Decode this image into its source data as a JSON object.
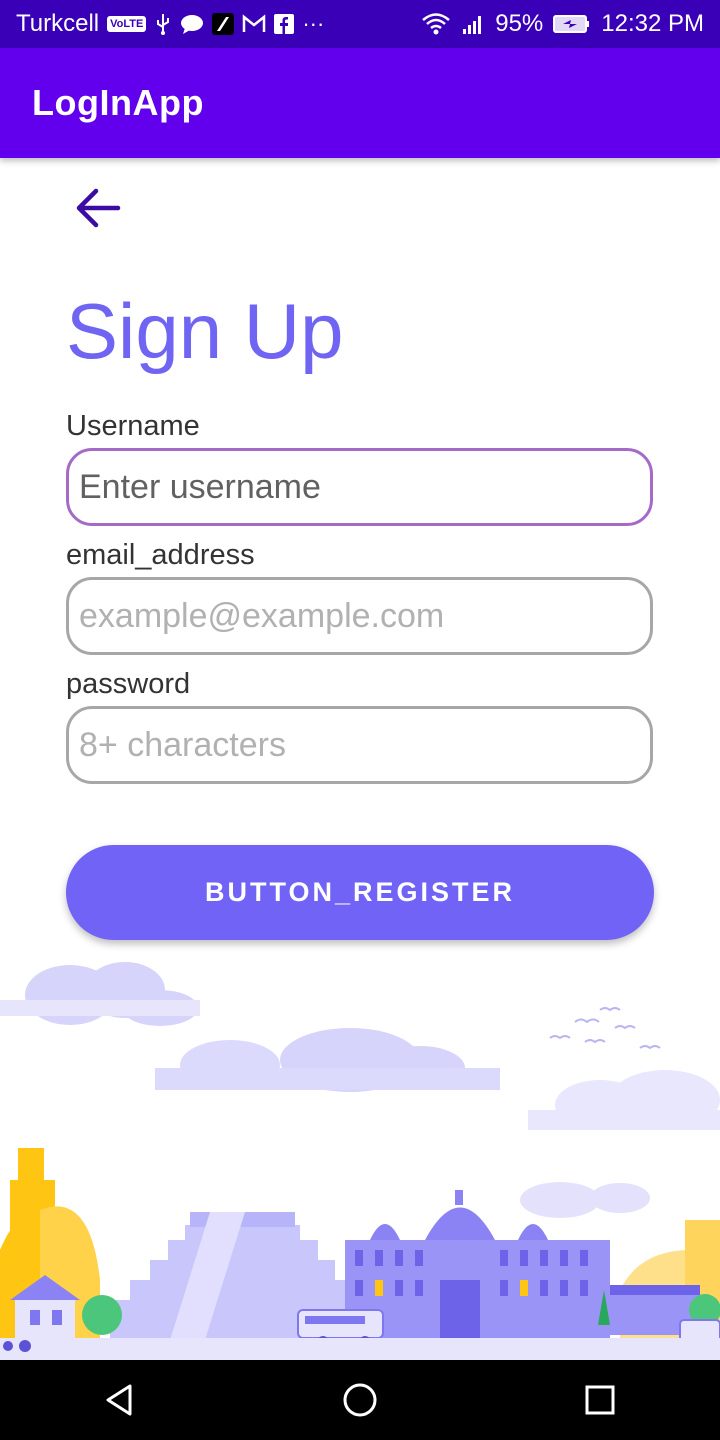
{
  "status_bar": {
    "carrier": "Turkcell",
    "volte": "VoLTE",
    "battery": "95%",
    "time": "12:32 PM",
    "overflow": "···"
  },
  "app_bar": {
    "title": "LogInApp"
  },
  "form": {
    "title": "Sign Up",
    "username_label": "Username",
    "username_placeholder": "Enter username",
    "email_label": "email_address",
    "email_placeholder": "example@example.com",
    "password_label": "password",
    "password_placeholder": "8+ characters",
    "register_label": "BUTTON_REGISTER"
  },
  "icons": {
    "back": "arrow-left-icon",
    "nav_back": "triangle-back-icon",
    "nav_home": "circle-home-icon",
    "nav_recents": "square-recents-icon"
  },
  "colors": {
    "status_bar": "#3a00b8",
    "app_bar": "#6200ee",
    "accent": "#7163f6",
    "title": "#7065f2",
    "focus_border": "#a56ac7"
  }
}
